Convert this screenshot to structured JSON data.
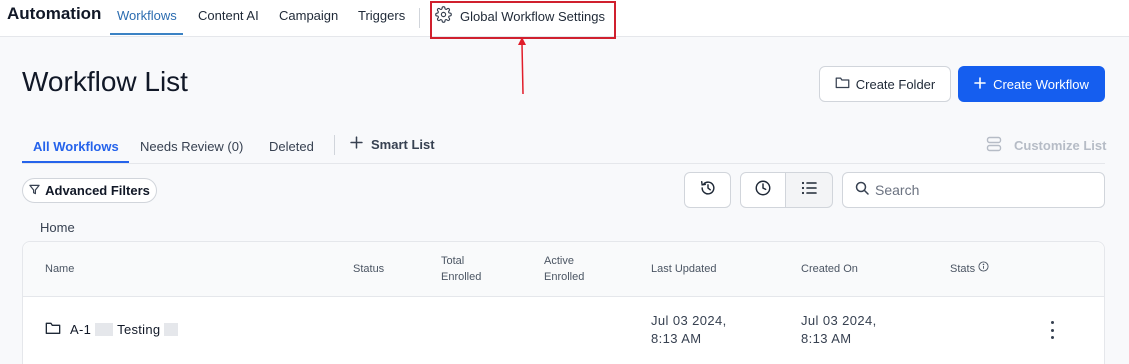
{
  "app": {
    "title": "Automation"
  },
  "nav": {
    "tabs": [
      {
        "label": "Workflows",
        "active": true
      },
      {
        "label": "Content AI"
      },
      {
        "label": "Campaign"
      },
      {
        "label": "Triggers"
      }
    ],
    "settings_label": "Global Workflow Settings",
    "settings_icon": "gear-icon"
  },
  "header": {
    "title": "Workflow List",
    "create_folder_label": "Create Folder",
    "create_workflow_label": "Create Workflow"
  },
  "subtabs": {
    "items": [
      {
        "label": "All Workflows",
        "active": true
      },
      {
        "label": "Needs Review (0)"
      },
      {
        "label": "Deleted"
      }
    ],
    "smart_list_label": "Smart List",
    "customize_list_label": "Customize List"
  },
  "filters": {
    "advanced_filters_label": "Advanced Filters",
    "search_placeholder": "Search"
  },
  "breadcrumb": "Home",
  "table": {
    "columns": {
      "name": "Name",
      "status": "Status",
      "total_enrolled": [
        "Total",
        "Enrolled"
      ],
      "active_enrolled": [
        "Active",
        "Enrolled"
      ],
      "last_updated": "Last Updated",
      "created_on": "Created On",
      "stats": "Stats"
    },
    "rows": [
      {
        "name_prefix": "A-1",
        "name_middle": "Testing",
        "last_updated": [
          "Jul 03 2024,",
          "8:13 AM"
        ],
        "created_on": [
          "Jul 03 2024,",
          "8:13 AM"
        ]
      }
    ]
  },
  "colors": {
    "accent": "#155eef",
    "active_tab": "#2b6cb0",
    "highlight": "#d0202e"
  }
}
